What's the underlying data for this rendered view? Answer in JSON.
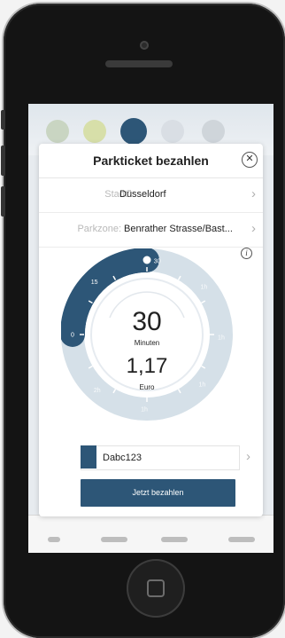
{
  "modal": {
    "title": "Parkticket bezahlen",
    "close_icon": "close-icon",
    "city_label": "Stadt:",
    "city_value": "Düsseldorf",
    "zone_label": "Parkzone:",
    "zone_value": "Benrather Strasse/Bast...",
    "info_glyph": "i"
  },
  "dial": {
    "selected_minutes_fraction": 0.1667,
    "max_hours": 3,
    "tick_labels": [
      "0",
      "15",
      "30",
      "1h",
      "1h",
      "1h",
      "1h",
      "2h",
      "1h"
    ],
    "minutes_value": "30",
    "minutes_unit": "Minuten",
    "euro_value": "1,17",
    "euro_unit": "Euro"
  },
  "vehicle": {
    "plate": "Dabc123"
  },
  "actions": {
    "pay_label": "Jetzt bezahlen"
  },
  "colors": {
    "accent": "#2d5677",
    "ring_track": "#d5e0e8",
    "ring_inner": "#e3eaf0"
  }
}
